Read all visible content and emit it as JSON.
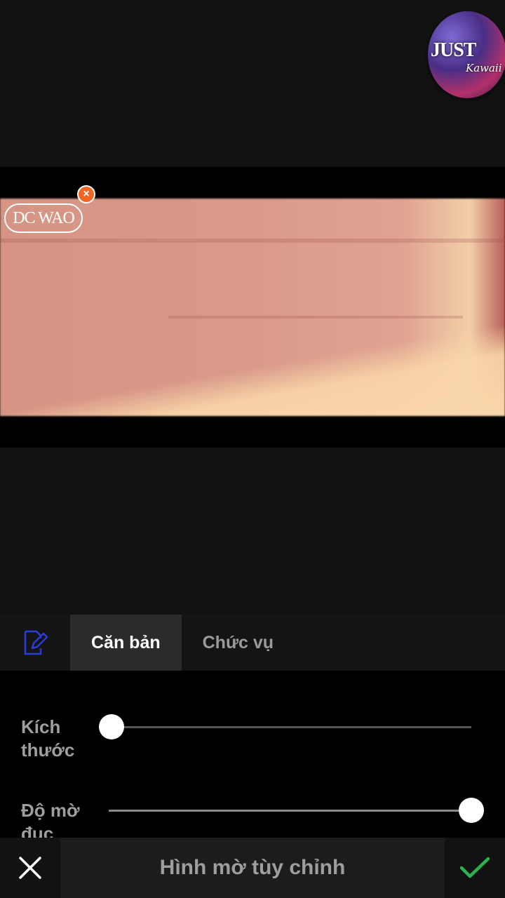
{
  "overlay": {
    "avatar_text": "JUST",
    "avatar_sub": "Kawaii"
  },
  "preview": {
    "watermark_text": "DC WAO",
    "watermark_close_symbol": "×"
  },
  "tabs": {
    "edit_icon": "edit-icon",
    "items": [
      {
        "label": "Căn bản",
        "active": true
      },
      {
        "label": "Chức vụ",
        "active": false
      }
    ]
  },
  "controls": {
    "size_label": "Kích thước",
    "size_value": 0,
    "opacity_label": "Độ mờ đục",
    "opacity_value": 100
  },
  "bottom_bar": {
    "title": "Hình mờ tùy chỉnh",
    "cancel_icon": "close-icon",
    "confirm_icon": "check-icon"
  },
  "colors": {
    "accent_orange": "#f26522",
    "confirm_green": "#2bb24c",
    "edit_icon_blue": "#2b3bd8"
  }
}
